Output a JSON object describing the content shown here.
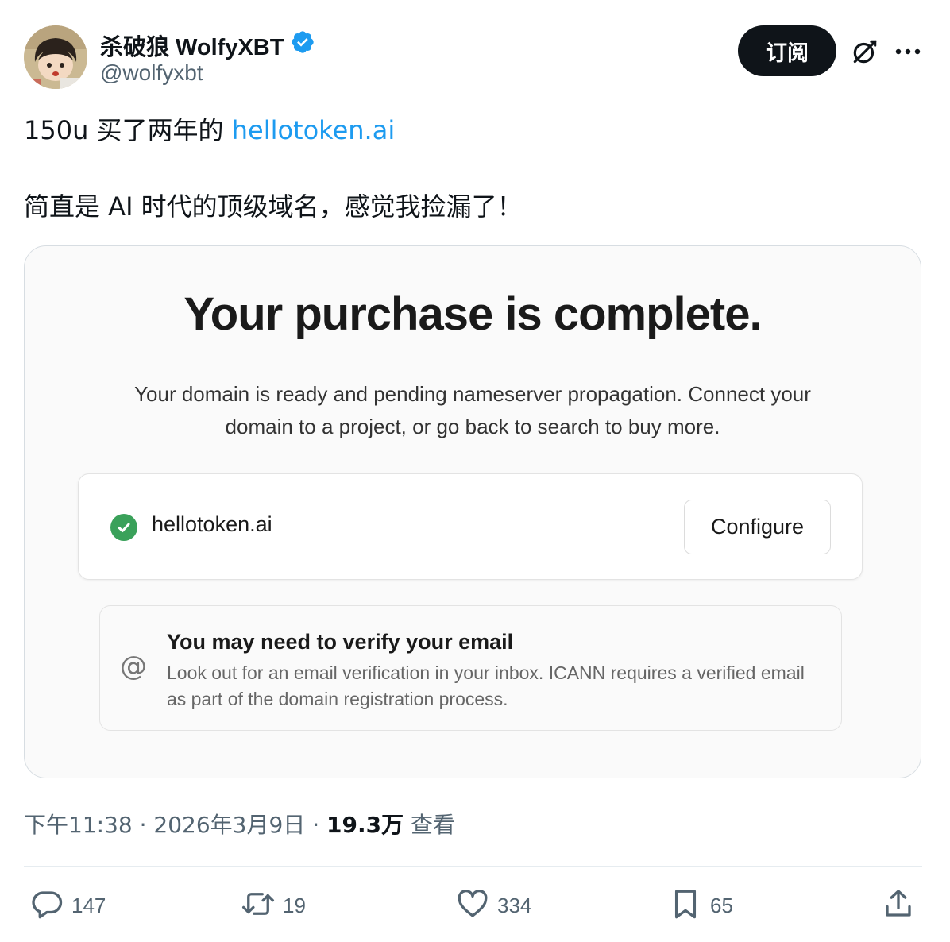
{
  "author": {
    "display_name": "杀破狼 WolfyXBT",
    "handle": "@wolfyxbt",
    "verified_icon": "verified-badge-icon"
  },
  "header_actions": {
    "subscribe_label": "订阅",
    "grok_icon": "grok-icon",
    "more_icon": "more-icon"
  },
  "tweet": {
    "line1_prefix": "150u 买了两年的 ",
    "line1_link": "hellotoken.ai",
    "line2": "简直是 AI 时代的顶级域名，感觉我捡漏了！"
  },
  "media": {
    "title": "Your purchase is complete.",
    "description_line1": "Your domain is ready and pending nameserver propagation. Connect your",
    "description_line2": "domain to a project, or go back to search to buy more.",
    "domain_name": "hellotoken.ai",
    "configure_label": "Configure",
    "email_notice_title": "You may need to verify your email",
    "email_notice_body": "Look out for an email verification in your inbox. ICANN requires a verified email as part of the domain registration process.",
    "at_symbol": "@",
    "accent_green": "#3aa15a"
  },
  "meta": {
    "time": "下午11:38",
    "separator": " · ",
    "date": "2026年3月9日",
    "views_count": "19.3万",
    "views_label": " 查看"
  },
  "engagement": {
    "replies": "147",
    "retweets": "19",
    "likes": "334",
    "bookmarks": "65"
  },
  "colors": {
    "link": "#1d9bf0",
    "subscribe_bg": "#0f1419",
    "secondary_text": "#536471"
  }
}
